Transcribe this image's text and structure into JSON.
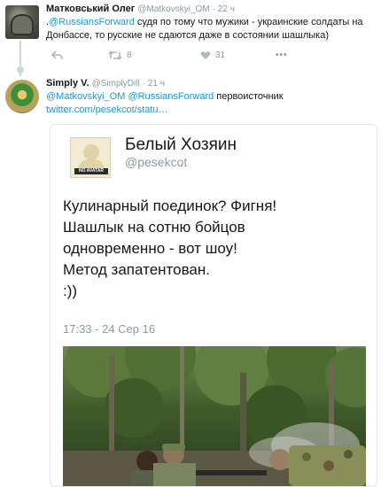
{
  "tweet1": {
    "author_name": "Матковський Олег",
    "handle": "@Matkovskyi_OM",
    "time": "· 22 ч",
    "mention_prefix": ".",
    "mention": "@RussiansForward",
    "text": " судя по тому что мужики - украинские солдаты на Донбассе, то русские не сдаются даже в состоянии шашлыка)",
    "actions": {
      "reply_icon": "reply-icon",
      "retweet_icon": "retweet-icon",
      "retweet_count": "8",
      "like_icon": "heart-icon",
      "like_count": "31",
      "more_icon": "more-icon",
      "more_label": "•••"
    }
  },
  "tweet2": {
    "author_name": "Simply V.",
    "handle": "@SimplyDill",
    "time": "· 21 ч",
    "mention1": "@Matkovskyi_OM",
    "mention2": "@RussiansForward",
    "text": " первоисточник",
    "link": "twitter.com/pesekcot/statu…"
  },
  "quoted": {
    "avatar_label": "NO AVATAR",
    "name": "Белый Хозяин",
    "handle": "@pesekcot",
    "lines": [
      "Кулинарный поединок? Фигня!",
      "Шашлык на сотню бойцов",
      "одновременно - вот шоу!",
      "Метод запатентован.",
      ":))"
    ],
    "date": "17:33 - 24 Сер 16"
  },
  "colors": {
    "link": "#1b95e0",
    "muted": "#8899a6",
    "text": "#14171a"
  }
}
